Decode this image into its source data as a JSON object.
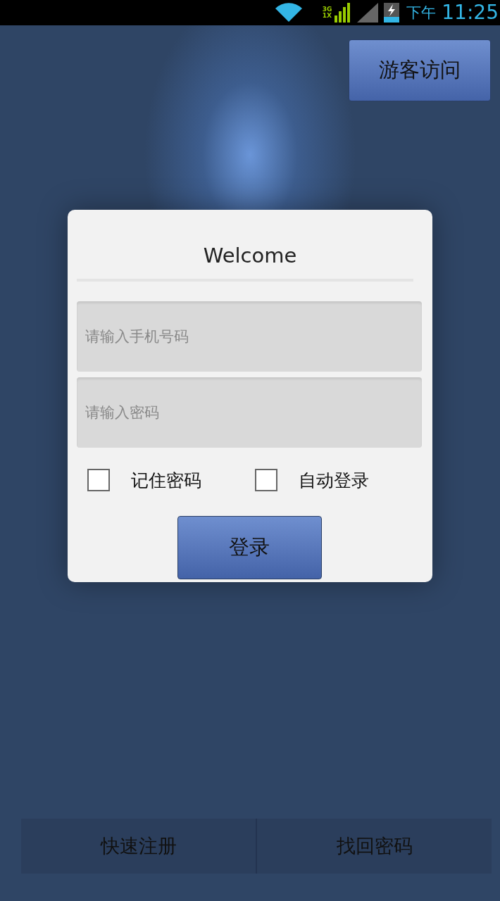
{
  "status_bar": {
    "network_labels": [
      "3G",
      "1X"
    ],
    "period": "下午",
    "time": "11:25"
  },
  "guest_button": "游客访问",
  "login_card": {
    "title": "Welcome",
    "fields": [
      {
        "placeholder": "请输入手机号码"
      },
      {
        "placeholder": "请输入密码"
      }
    ],
    "options": [
      {
        "label": "记住密码",
        "checked": false
      },
      {
        "label": "自动登录",
        "checked": false
      }
    ],
    "login_button": "登录"
  },
  "bottom_bar": [
    "快速注册",
    "找回密码"
  ]
}
